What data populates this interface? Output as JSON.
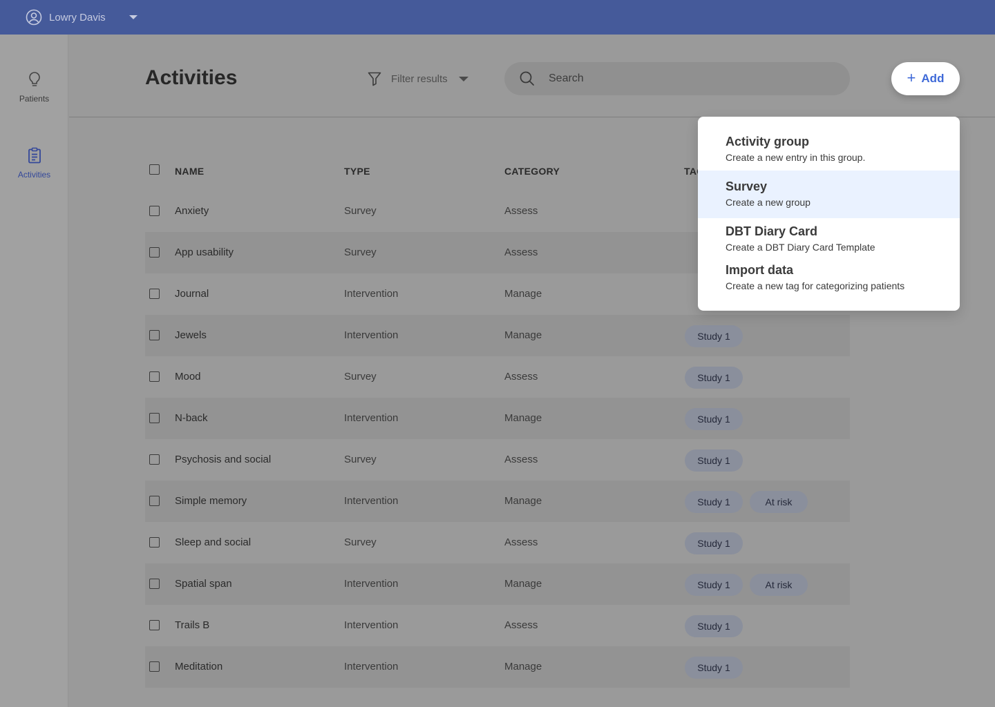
{
  "topbar": {
    "user_name": "Lowry Davis"
  },
  "sidebar": {
    "items": [
      {
        "label": "Patients"
      },
      {
        "label": "Activities"
      }
    ]
  },
  "header": {
    "title": "Activities",
    "filter_label": "Filter results",
    "search_placeholder": "Search",
    "add_label": "Add"
  },
  "table": {
    "columns": [
      "NAME",
      "TYPE",
      "CATEGORY",
      "TAGS"
    ],
    "rows": [
      {
        "name": "Anxiety",
        "type": "Survey",
        "category": "Assess",
        "tags": []
      },
      {
        "name": "App usability",
        "type": "Survey",
        "category": "Assess",
        "tags": []
      },
      {
        "name": "Journal",
        "type": "Intervention",
        "category": "Manage",
        "tags": []
      },
      {
        "name": "Jewels",
        "type": "Intervention",
        "category": "Manage",
        "tags": [
          "Study 1"
        ]
      },
      {
        "name": "Mood",
        "type": "Survey",
        "category": "Assess",
        "tags": [
          "Study 1"
        ]
      },
      {
        "name": "N-back",
        "type": "Intervention",
        "category": "Manage",
        "tags": [
          "Study 1"
        ]
      },
      {
        "name": "Psychosis and social",
        "type": "Survey",
        "category": "Assess",
        "tags": [
          "Study 1"
        ]
      },
      {
        "name": "Simple memory",
        "type": "Intervention",
        "category": "Manage",
        "tags": [
          "Study 1",
          "At risk"
        ]
      },
      {
        "name": "Sleep and social",
        "type": "Survey",
        "category": "Assess",
        "tags": [
          "Study 1"
        ]
      },
      {
        "name": "Spatial span",
        "type": "Intervention",
        "category": "Manage",
        "tags": [
          "Study 1",
          "At risk"
        ]
      },
      {
        "name": "Trails B",
        "type": "Intervention",
        "category": "Assess",
        "tags": [
          "Study 1"
        ]
      },
      {
        "name": "Meditation",
        "type": "Intervention",
        "category": "Manage",
        "tags": [
          "Study 1"
        ]
      }
    ]
  },
  "add_menu": {
    "items": [
      {
        "title": "Activity group",
        "subtitle": "Create a new entry in this group."
      },
      {
        "title": "Survey",
        "subtitle": "Create a new group"
      },
      {
        "title": "DBT Diary Card",
        "subtitle": "Create a DBT Diary Card Template"
      },
      {
        "title": "Import data",
        "subtitle": "Create a new tag for categorizing patients"
      }
    ],
    "highlighted": "Survey"
  },
  "colors": {
    "topbar": "#455a9a",
    "accent": "#3f6ad8",
    "highlight": "#eaf2ff"
  }
}
